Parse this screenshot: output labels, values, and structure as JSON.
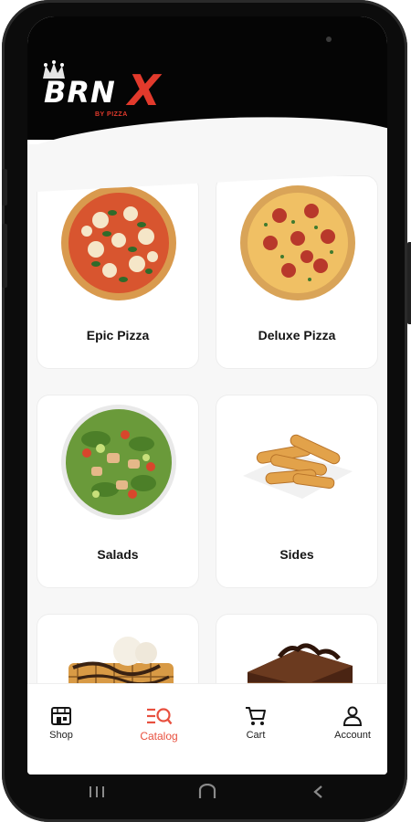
{
  "brand": {
    "logo_text": "BRN",
    "logo_accent": "X",
    "logo_sub": "BY PIZZA",
    "accent_color": "#e23a2c"
  },
  "catalog": {
    "items": [
      {
        "label": "Epic Pizza",
        "image": "pizza-margherita"
      },
      {
        "label": "Deluxe Pizza",
        "image": "pizza-pepperoni"
      },
      {
        "label": "Salads",
        "image": "salad-bowl"
      },
      {
        "label": "Sides",
        "image": "mozzarella-sticks"
      },
      {
        "label": "",
        "image": "waffle-dessert"
      },
      {
        "label": "",
        "image": "chocolate-cake"
      }
    ]
  },
  "nav": {
    "active_color": "#e8503f",
    "items": [
      {
        "label": "Shop",
        "icon": "shop-icon",
        "active": false
      },
      {
        "label": "Catalog",
        "icon": "catalog-icon",
        "active": true
      },
      {
        "label": "Cart",
        "icon": "cart-icon",
        "active": false
      },
      {
        "label": "Account",
        "icon": "account-icon",
        "active": false
      }
    ]
  },
  "system_nav": {
    "buttons": [
      "recents-icon",
      "home-icon",
      "back-icon"
    ]
  }
}
